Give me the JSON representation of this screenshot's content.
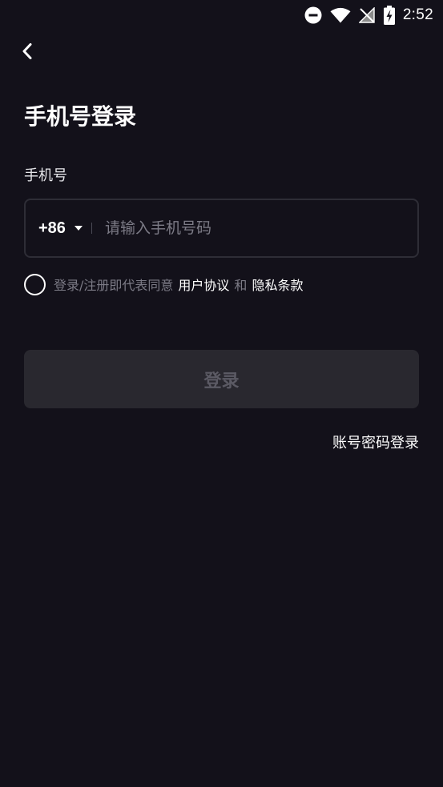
{
  "status_bar": {
    "time": "2:52",
    "icons": [
      "do-not-disturb-icon",
      "wifi-icon",
      "no-signal-icon",
      "battery-charging-icon"
    ]
  },
  "header": {
    "back_icon": "chevron-left-icon"
  },
  "page": {
    "title": "手机号登录",
    "phone_label": "手机号"
  },
  "phone_input": {
    "country_code": "+86",
    "caret_icon": "caret-down-icon",
    "placeholder": "请输入手机号码",
    "value": ""
  },
  "agreement": {
    "prefix": "登录/注册即代表同意",
    "user_agreement": "用户协议",
    "conjunction": "和",
    "privacy_policy": "隐私条款",
    "checked": false
  },
  "actions": {
    "login_label": "登录",
    "password_login_label": "账号密码登录"
  },
  "colors": {
    "background": "#13111a",
    "input_border": "#2e2d36",
    "button_disabled_bg": "#29282f",
    "button_disabled_text": "#5b5a64",
    "muted_text": "#7c7b86",
    "text": "#ffffff"
  }
}
